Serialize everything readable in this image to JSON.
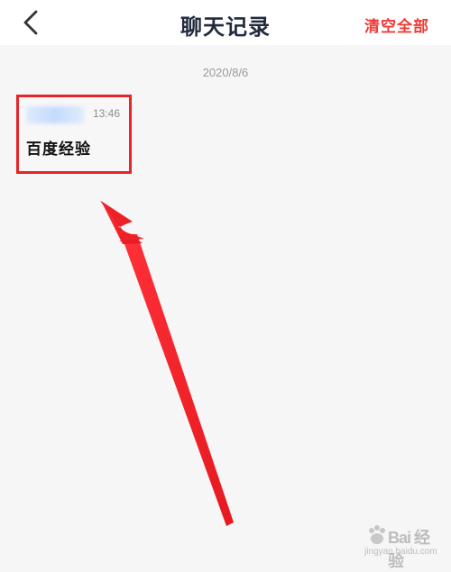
{
  "header": {
    "title": "聊天记录",
    "clear_label": "清空全部"
  },
  "history": {
    "date": "2020/8/6",
    "messages": [
      {
        "time": "13:46",
        "text": "百度经验"
      }
    ]
  },
  "watermark": {
    "brand": "Bai 经验",
    "url": "jingyan.baidu.com"
  },
  "colors": {
    "accent": "#ef3b36",
    "highlight": "#e5242a",
    "background": "#f6f6f6"
  }
}
